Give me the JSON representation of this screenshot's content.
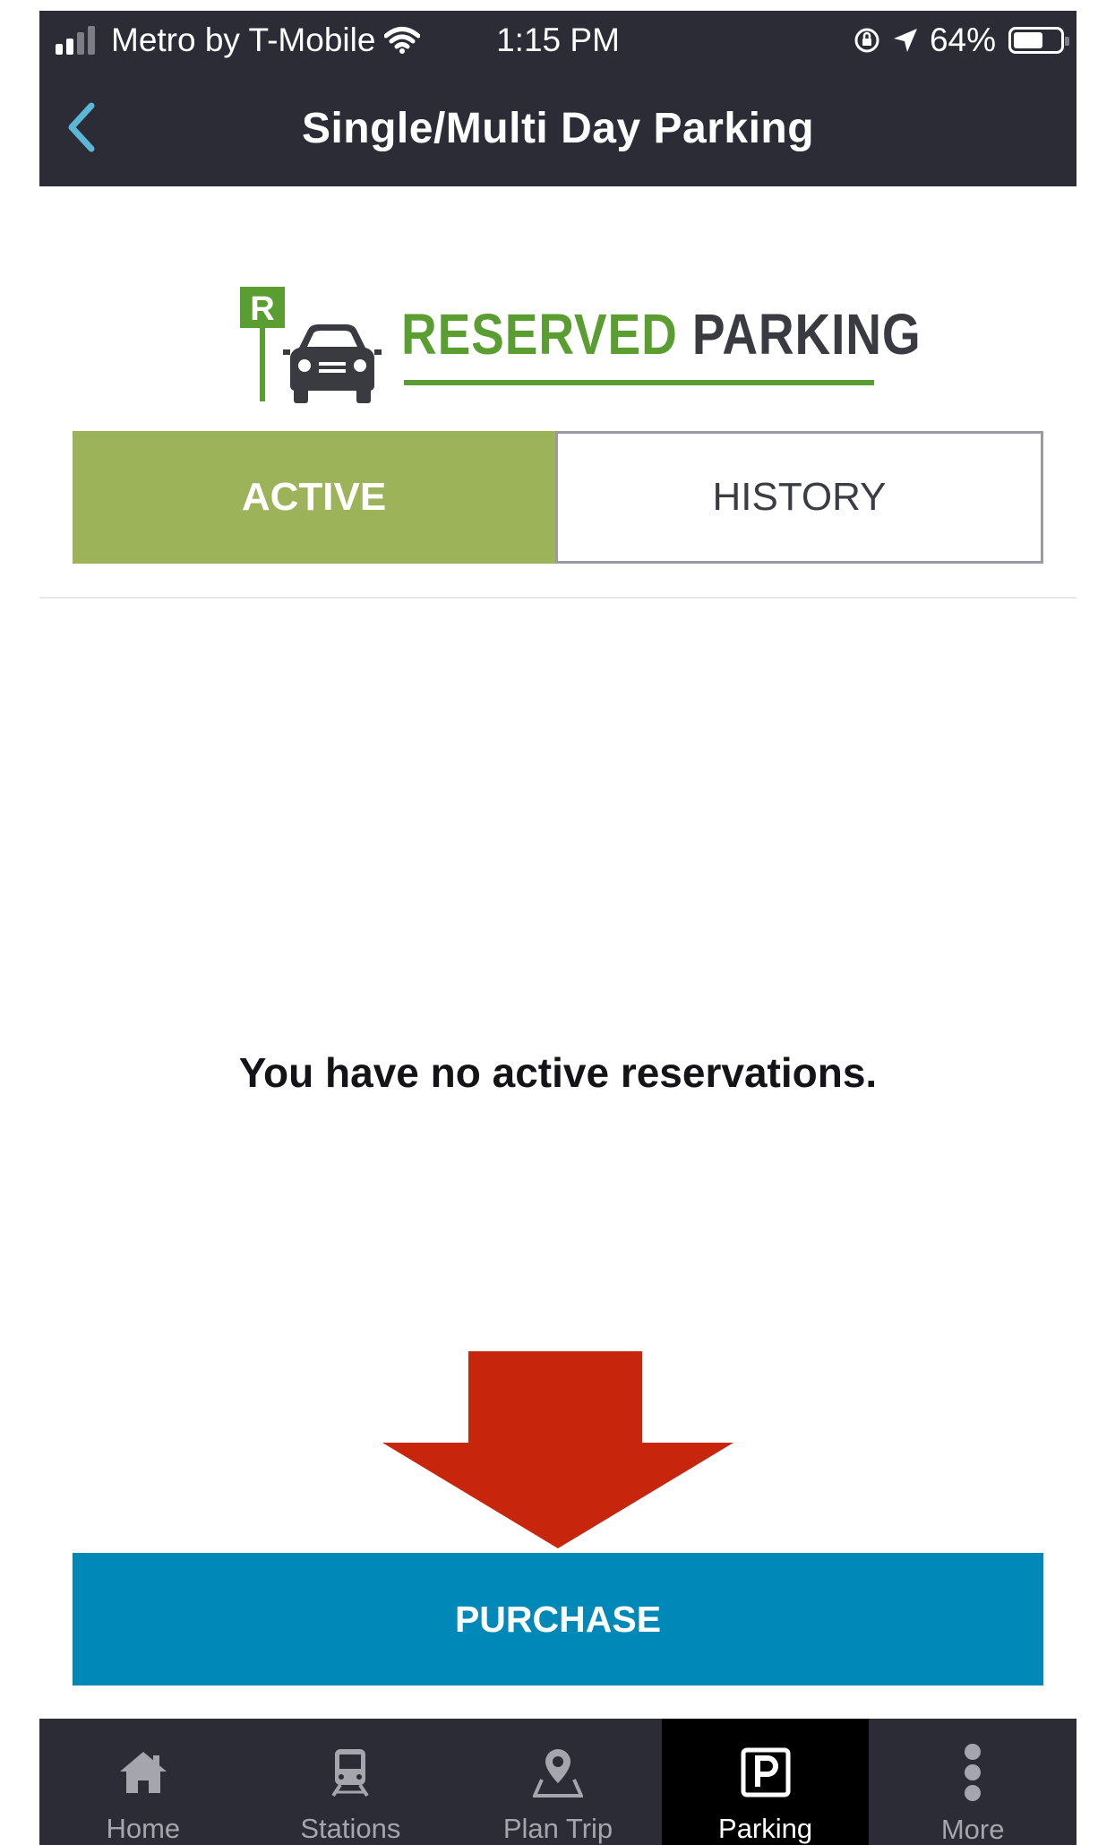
{
  "status_bar": {
    "carrier": "Metro by T-Mobile",
    "time": "1:15 PM",
    "battery": "64%",
    "battery_level": 0.64,
    "icons": [
      "signal-icon",
      "wifi-icon",
      "rotation-lock-icon",
      "location-icon",
      "battery-icon"
    ]
  },
  "header": {
    "title": "Single/Multi Day Parking",
    "back_icon": "chevron-left-icon"
  },
  "logo": {
    "word1": "RESERVED",
    "word2": "PARKING",
    "sign_letter": "R"
  },
  "tabs": {
    "active_label": "ACTIVE",
    "history_label": "HISTORY",
    "selected": "ACTIVE"
  },
  "main": {
    "empty_message": "You have no active reservations."
  },
  "purchase": {
    "label": "PURCHASE"
  },
  "tab_bar": {
    "items": [
      {
        "label": "Home",
        "icon": "home-icon"
      },
      {
        "label": "Stations",
        "icon": "train-icon"
      },
      {
        "label": "Plan Trip",
        "icon": "map-pin-icon"
      },
      {
        "label": "Parking",
        "icon": "parking-icon"
      },
      {
        "label": "More",
        "icon": "more-vertical-icon"
      }
    ],
    "selected": "Parking"
  },
  "colors": {
    "header_bg": "#2b2c36",
    "active_tab": "#9cb35a",
    "logo_green": "#5a9e32",
    "purchase_bg": "#0089b8",
    "arrow_red": "#c8260c",
    "back_accent": "#5bb7d6"
  }
}
